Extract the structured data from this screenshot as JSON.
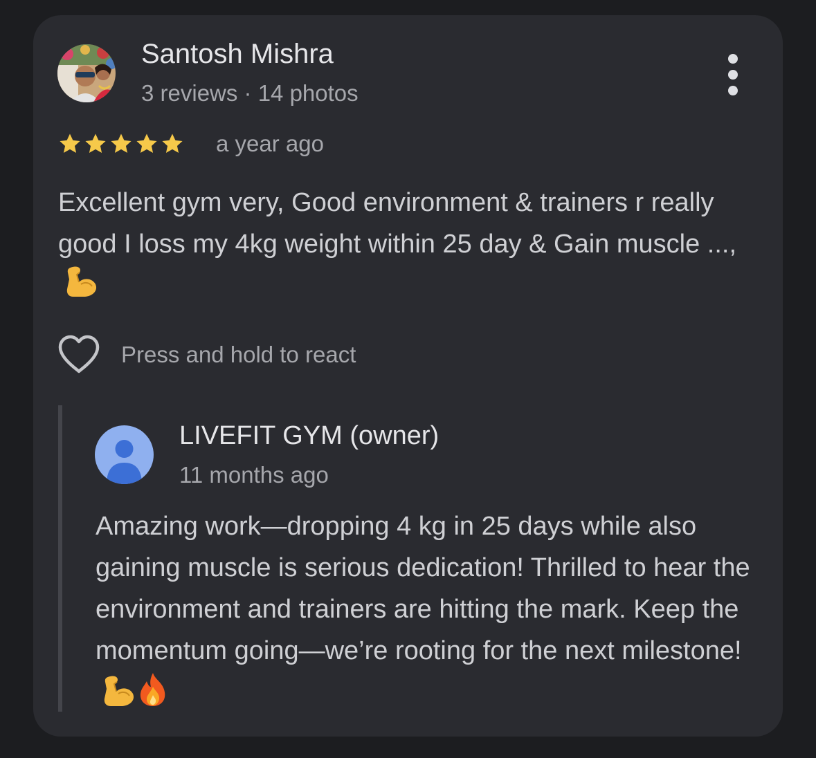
{
  "review": {
    "author_name": "Santosh Mishra",
    "author_meta": "3 reviews · 14 photos",
    "rating": 5,
    "rating_max": 5,
    "star_color": "#f6c94a",
    "age": "a year ago",
    "text": "Excellent gym very, Good environment & trainers r really good I loss my 4kg weight within 25 day & Gain muscle ...,",
    "text_emoji": "flexed-biceps-emoji",
    "react_label": "Press and hold to react",
    "more_icon": "more-vertical-icon"
  },
  "owner_reply": {
    "owner_name": "LIVEFIT GYM (owner)",
    "age": "11 months ago",
    "avatar_icon": "person-icon",
    "text": "Amazing work—dropping 4 kg in 25 days while also gaining muscle is serious dedication! Thrilled to hear the environment and trainers are hitting the mark. Keep the momentum going—we’re rooting for the next milestone!",
    "text_emojis": [
      "flexed-biceps-emoji",
      "fire-emoji"
    ]
  },
  "colors": {
    "background": "#1c1d20",
    "card": "#2a2b30",
    "primary_text": "#e6e6e9",
    "secondary_text": "#a6a7ac",
    "owner_avatar": "#8fb0ef"
  }
}
